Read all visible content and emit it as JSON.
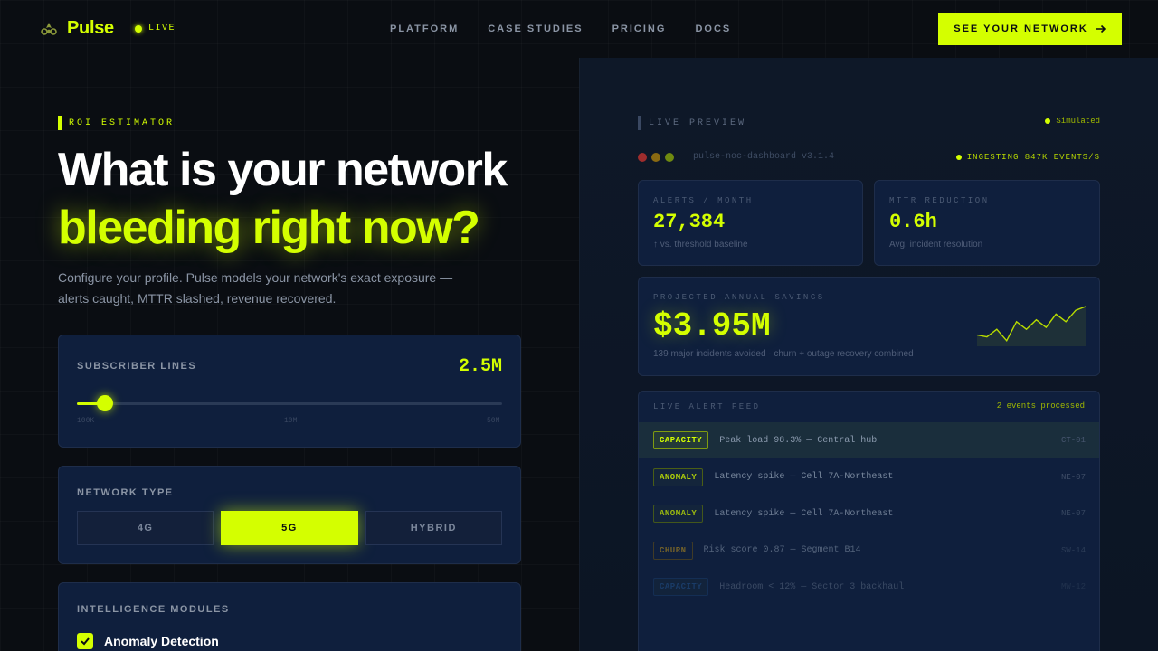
{
  "nav": {
    "brand": "Pulse",
    "live_label": "LIVE",
    "links": [
      "PLATFORM",
      "CASE STUDIES",
      "PRICING",
      "DOCS"
    ],
    "cta_label": "SEE YOUR NETWORK"
  },
  "hero": {
    "eyebrow": "ROI ESTIMATOR",
    "title_line1": "What is your network",
    "title_line2": "bleeding right now?",
    "subtitle": "Configure your profile. Pulse models your network's exact exposure — alerts caught, MTTR slashed, revenue recovered."
  },
  "subscriber": {
    "label": "SUBSCRIBER LINES",
    "value": "2.5M",
    "fill_percent": 6.5,
    "ticks": [
      "100K",
      "10M",
      "50M"
    ]
  },
  "network_type": {
    "label": "NETWORK TYPE",
    "options": [
      "4G",
      "5G",
      "HYBRID"
    ],
    "selected": "5G"
  },
  "modules": {
    "label": "INTELLIGENCE MODULES",
    "items": [
      {
        "label": "Anomaly Detection",
        "checked": true
      }
    ]
  },
  "preview": {
    "eyebrow": "LIVE PREVIEW",
    "simulated": "Simulated",
    "window_title": "pulse-noc-dashboard v3.1.4",
    "ingesting": "INGESTING 847K EVENTS/S",
    "alerts": {
      "label": "ALERTS / MONTH",
      "value": "27,384",
      "sub": "↑ vs. threshold baseline"
    },
    "mttr": {
      "label": "MTTR REDUCTION",
      "value": "0.6h",
      "sub": "Avg. incident resolution"
    },
    "savings": {
      "label": "PROJECTED ANNUAL SAVINGS",
      "value": "$3.95M",
      "sub": "139 major incidents avoided · churn + outage recovery combined",
      "sparkline": [
        0.25,
        0.2,
        0.4,
        0.1,
        0.6,
        0.4,
        0.65,
        0.45,
        0.8,
        0.6,
        0.9,
        1.0
      ]
    },
    "feed": {
      "label": "LIVE ALERT FEED",
      "processed": "2 events processed",
      "rows": [
        {
          "tag": "CAPACITY",
          "msg": "Peak load 98.3% — Central hub",
          "code": "CT-01"
        },
        {
          "tag": "ANOMALY",
          "msg": "Latency spike — Cell 7A-Northeast",
          "code": "NE-07"
        },
        {
          "tag": "ANOMALY",
          "msg": "Latency spike — Cell 7A-Northeast",
          "code": "NE-07"
        },
        {
          "tag": "CHURN",
          "msg": "Risk score 0.87 — Segment B14",
          "code": "SW-14"
        },
        {
          "tag": "CAPACITY",
          "msg": "Headroom < 12% — Sector 3 backhaul",
          "code": "MW-12"
        }
      ]
    }
  },
  "colors": {
    "accent": "#d4ff00",
    "background": "#0a0d12",
    "card": "#0f1f3d",
    "window_dots": [
      "#c0392b",
      "#b7791f",
      "#8aa010"
    ]
  }
}
